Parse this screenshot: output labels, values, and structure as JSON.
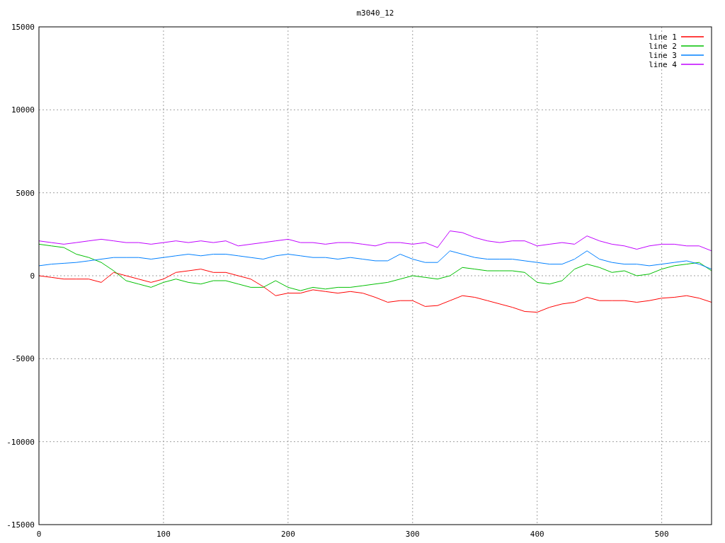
{
  "plot": {
    "chart_data": {
      "type": "line",
      "title": "m3040_12",
      "x": [
        0,
        10,
        20,
        30,
        40,
        50,
        60,
        70,
        80,
        90,
        100,
        110,
        120,
        130,
        140,
        150,
        160,
        170,
        180,
        190,
        200,
        210,
        220,
        230,
        240,
        250,
        260,
        270,
        280,
        290,
        300,
        310,
        320,
        330,
        340,
        350,
        360,
        370,
        380,
        390,
        400,
        410,
        420,
        430,
        440,
        450,
        460,
        470,
        480,
        490,
        500,
        510,
        520,
        530,
        540
      ],
      "series": [
        {
          "name": "line 1",
          "color": "#ff0000",
          "values": [
            0,
            -100,
            -200,
            -200,
            -200,
            -400,
            200,
            0,
            -200,
            -400,
            -200,
            200,
            300,
            400,
            200,
            200,
            0,
            -200,
            -650,
            -1200,
            -1050,
            -1050,
            -850,
            -950,
            -1050,
            -950,
            -1050,
            -1300,
            -1600,
            -1500,
            -1500,
            -1850,
            -1800,
            -1500,
            -1200,
            -1300,
            -1500,
            -1700,
            -1900,
            -2150,
            -2200,
            -1900,
            -1700,
            -1600,
            -1300,
            -1500,
            -1500,
            -1500,
            -1600,
            -1500,
            -1350,
            -1300,
            -1200,
            -1350,
            -1600
          ]
        },
        {
          "name": "line 2",
          "color": "#00c000",
          "values": [
            1900,
            1800,
            1700,
            1300,
            1100,
            800,
            300,
            -300,
            -500,
            -700,
            -400,
            -200,
            -400,
            -500,
            -300,
            -300,
            -500,
            -700,
            -700,
            -300,
            -700,
            -900,
            -700,
            -800,
            -700,
            -700,
            -600,
            -500,
            -400,
            -200,
            0,
            -100,
            -200,
            0,
            500,
            400,
            300,
            300,
            300,
            200,
            -400,
            -500,
            -300,
            400,
            700,
            500,
            200,
            300,
            0,
            100,
            400,
            600,
            700,
            800,
            300
          ]
        },
        {
          "name": "line 3",
          "color": "#0080ff",
          "values": [
            600,
            700,
            750,
            800,
            900,
            1000,
            1100,
            1100,
            1100,
            1000,
            1100,
            1200,
            1300,
            1200,
            1300,
            1300,
            1200,
            1100,
            1000,
            1200,
            1300,
            1200,
            1100,
            1100,
            1000,
            1100,
            1000,
            900,
            900,
            1300,
            1000,
            800,
            800,
            1500,
            1300,
            1100,
            1000,
            1000,
            1000,
            900,
            800,
            700,
            700,
            1000,
            1500,
            1000,
            800,
            700,
            700,
            600,
            700,
            800,
            900,
            700,
            400
          ]
        },
        {
          "name": "line 4",
          "color": "#c000ff",
          "values": [
            2100,
            2000,
            1900,
            2000,
            2100,
            2200,
            2100,
            2000,
            2000,
            1900,
            2000,
            2100,
            2000,
            2100,
            2000,
            2100,
            1800,
            1900,
            2000,
            2100,
            2200,
            2000,
            2000,
            1900,
            2000,
            2000,
            1900,
            1800,
            2000,
            2000,
            1900,
            2000,
            1700,
            2700,
            2600,
            2300,
            2100,
            2000,
            2100,
            2100,
            1800,
            1900,
            2000,
            1900,
            2400,
            2100,
            1900,
            1800,
            1600,
            1800,
            1900,
            1900,
            1800,
            1800,
            1500
          ]
        }
      ],
      "grid": true,
      "legend": true,
      "xlim": [
        0,
        540
      ],
      "ylim": [
        -15000,
        15000
      ],
      "xticks": [
        0,
        100,
        200,
        300,
        400,
        500
      ],
      "yticks": [
        -15000,
        -10000,
        -5000,
        0,
        5000,
        10000,
        15000
      ]
    }
  }
}
